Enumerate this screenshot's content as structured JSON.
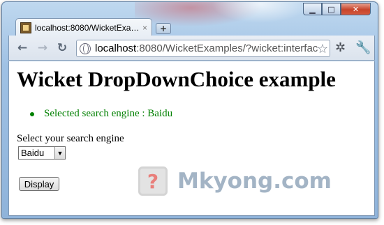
{
  "window": {
    "tab_title": "localhost:8080/WicketExa…",
    "tab_close": "×",
    "new_tab": "+",
    "controls": {
      "minimize": "▁",
      "maximize": "□",
      "close": "✕"
    }
  },
  "toolbar": {
    "back_icon": "←",
    "forward_icon": "→",
    "reload_icon": "↻",
    "url_host": "localhost",
    "url_rest": ":8080/WicketExamples/?wicket:interfac",
    "star_icon": "☆",
    "extension_icon": "✲",
    "wrench_icon": "🔧"
  },
  "page": {
    "heading": "Wicket DropDownChoice example",
    "feedback": "Selected search engine : Baidu",
    "select_label": "Select your search engine",
    "selected_value": "Baidu",
    "button_label": "Display"
  },
  "watermark": {
    "icon_glyph": "?",
    "text": "Mkyong.com"
  },
  "colors": {
    "feedback_green": "#008000",
    "chrome_blue": "#9fc1e4"
  }
}
